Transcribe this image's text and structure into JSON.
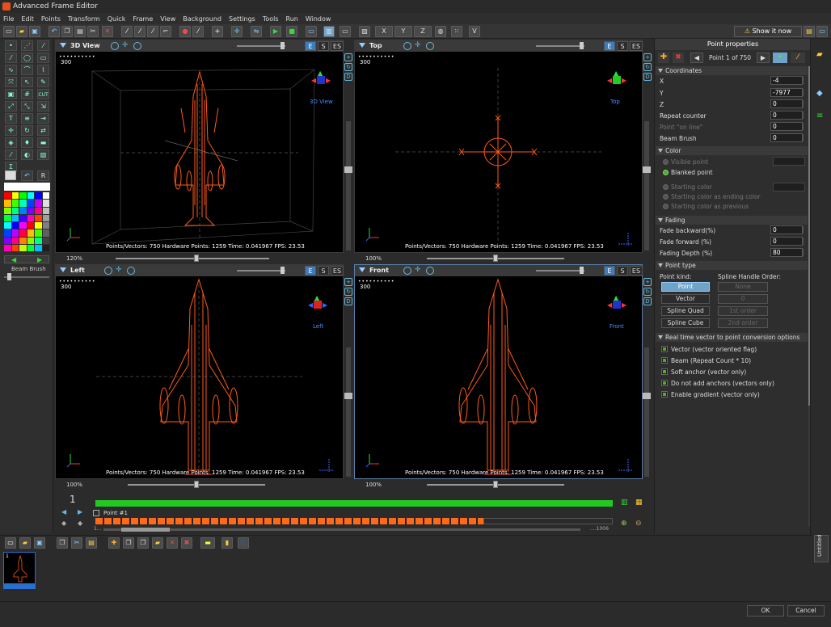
{
  "window": {
    "title": "Advanced Frame Editor"
  },
  "menu": [
    "File",
    "Edit",
    "Points",
    "Transform",
    "Quick",
    "Frame",
    "View",
    "Background",
    "Settings",
    "Tools",
    "Run",
    "Window"
  ],
  "toolbar": {
    "show_it_now": "Show it now",
    "v_label": "V",
    "x_label": "X",
    "y_label": "Y",
    "z_label": "Z"
  },
  "left_tools": {
    "beam_brush": "Beam Brush",
    "cut_label": "CUT",
    "r_label": "R",
    "sigma_label": "Σ"
  },
  "palette_colors": [
    "#ff0000",
    "#ff4000",
    "#ff8000",
    "#ffbf00",
    "#ffff00",
    "#bfff00",
    "#80ff00",
    "#40ff00",
    "#00ff00",
    "#00ff40",
    "#00ff80",
    "#00ffbf",
    "#00ffff",
    "#00bfff",
    "#0080ff",
    "#0040ff",
    "#0000ff",
    "#4000ff",
    "#8000ff",
    "#bf00ff",
    "#ff00ff",
    "#ff00bf",
    "#ff0080",
    "#ff0040"
  ],
  "viewports": [
    {
      "name": "3D View",
      "label": "3D View",
      "zoom": "120%",
      "counter": "300",
      "dots": "••••••••••",
      "stats": "Points/Vectors: 750    Hardware Points: 1259    Time: 0.041967    FPS: 23.53"
    },
    {
      "name": "Top",
      "label": "Top",
      "zoom": "100%",
      "counter": "300",
      "dots": "••••••••••",
      "stats": "Points/Vectors: 750    Hardware Points: 1259    Time: 0.041967    FPS: 23.53"
    },
    {
      "name": "Left",
      "label": "Left",
      "zoom": "100%",
      "counter": "300",
      "dots": "••••••••••",
      "stats": "Points/Vectors: 750    Hardware Points: 1259    Time: 0.041967    FPS: 23.53"
    },
    {
      "name": "Front",
      "label": "Front",
      "zoom": "100%",
      "counter": "300",
      "dots": "••••••••••",
      "stats": "Points/Vectors: 750    Hardware Points: 1259    Time: 0.041967    FPS: 23.53"
    }
  ],
  "vp_buttons": {
    "e": "E",
    "s": "S",
    "es": "ES"
  },
  "timeline": {
    "frame_number": "1",
    "point_label": "Point #1",
    "start": "1...",
    "end": "....1006"
  },
  "properties": {
    "title": "Point properties",
    "point_nav": "Point 1 of 750",
    "coordinates": {
      "header": "Coordinates",
      "fields": [
        {
          "label": "X",
          "value": "-4"
        },
        {
          "label": "Y",
          "value": "-7977"
        },
        {
          "label": "Z",
          "value": "0"
        },
        {
          "label": "Repeat counter",
          "value": "0"
        },
        {
          "label": "Point \"on line\"",
          "value": "0"
        },
        {
          "label": "Beam Brush",
          "value": "0"
        }
      ]
    },
    "color": {
      "header": "Color",
      "visible_point": "Visible point",
      "blanked_point": "Blanked point",
      "starting_color": "Starting color",
      "starting_as_ending": "Starting color as ending color",
      "starting_as_previous": "Starting color as previous"
    },
    "fading": {
      "header": "Fading",
      "fields": [
        {
          "label": "Fade backward(%)",
          "value": "0"
        },
        {
          "label": "Fade forward (%)",
          "value": "0"
        },
        {
          "label": "Fading Depth (%)",
          "value": "80"
        }
      ]
    },
    "point_type": {
      "header": "Point type",
      "kind_label": "Point kind:",
      "order_label": "Spline Handle Order:",
      "kinds": [
        "Point",
        "Vector",
        "Spline Quad",
        "Spline Cube"
      ],
      "orders": [
        "None",
        "0",
        "1st order",
        "2nd order"
      ]
    },
    "realtime": {
      "header": "Real time vector to point conversion options",
      "options": [
        "Vector (vector oriented flag)",
        "Beam (Repeat Count * 10)",
        "Soft anchor (vector only)",
        "Do not add anchors (vectors only)",
        "Enable gradient (vector only)"
      ]
    }
  },
  "frames": {
    "thumb_number": "1"
  },
  "side_tab": "Untitled",
  "dialog": {
    "ok": "OK",
    "cancel": "Cancel"
  }
}
